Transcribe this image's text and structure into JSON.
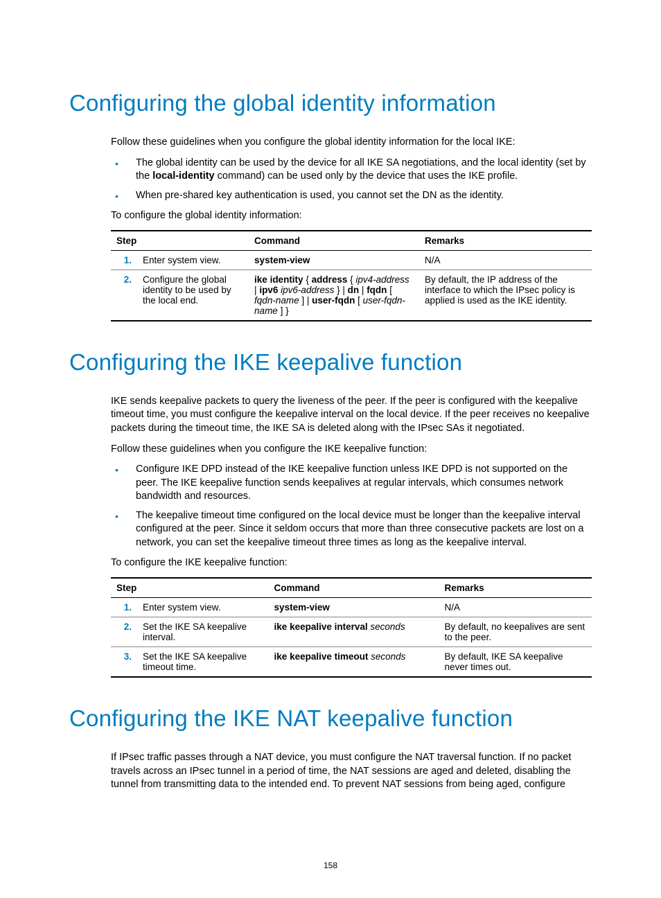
{
  "page_number": "158",
  "sections": [
    {
      "heading": "Configuring the global identity information",
      "intro_paragraphs": [
        "Follow these guidelines when you configure the global identity information for the local IKE:"
      ],
      "bullets": [
        {
          "pre": "The global identity can be used by the device for all IKE SA negotiations, and the local identity (set by the ",
          "bold": "local-identity",
          "post": " command) can be used only by the device that uses the IKE profile."
        },
        {
          "pre": "When pre-shared key authentication is used, you cannot set the DN as the identity.",
          "bold": "",
          "post": ""
        }
      ],
      "lead_out": "To configure the global identity information:",
      "table_headers": {
        "step": "Step",
        "command": "Command",
        "remarks": "Remarks"
      },
      "rows": [
        {
          "num": "1.",
          "desc": "Enter system view.",
          "command_segments": [
            {
              "t": "system-view",
              "b": true
            }
          ],
          "remarks": "N/A"
        },
        {
          "num": "2.",
          "desc": "Configure the global identity to be used by the local end.",
          "command_segments": [
            {
              "t": "ike identity",
              "b": true
            },
            {
              "t": " { "
            },
            {
              "t": "address",
              "b": true
            },
            {
              "t": " { "
            },
            {
              "t": "ipv4-address",
              "i": true
            },
            {
              "t": " | "
            },
            {
              "t": "ipv6",
              "b": true
            },
            {
              "t": " "
            },
            {
              "t": "ipv6-address",
              "i": true
            },
            {
              "t": " } | "
            },
            {
              "t": "dn",
              "b": true
            },
            {
              "t": " | "
            },
            {
              "t": "fqdn",
              "b": true
            },
            {
              "t": " [ "
            },
            {
              "t": "fqdn-name",
              "i": true
            },
            {
              "t": " ] | "
            },
            {
              "t": "user-fqdn",
              "b": true
            },
            {
              "t": " [ "
            },
            {
              "t": "user-fqdn-name",
              "i": true
            },
            {
              "t": " ] }"
            }
          ],
          "remarks": "By default, the IP address of the interface to which the IPsec policy is applied is used as the IKE identity."
        }
      ]
    },
    {
      "heading": "Configuring the IKE keepalive function",
      "intro_paragraphs": [
        "IKE sends keepalive packets to query the liveness of the peer. If the peer is configured with the keepalive timeout time, you must configure the keepalive interval on the local device. If the peer receives no keepalive packets during the timeout time, the IKE SA is deleted along with the IPsec SAs it negotiated.",
        "Follow these guidelines when you configure the IKE keepalive function:"
      ],
      "bullets": [
        {
          "pre": "Configure IKE DPD instead of the IKE keepalive function unless IKE DPD is not supported on the peer. The IKE keepalive function sends keepalives at regular intervals, which consumes network bandwidth and resources.",
          "bold": "",
          "post": ""
        },
        {
          "pre": "The keepalive timeout time configured on the local device must be longer than the keepalive interval configured at the peer. Since it seldom occurs that more than three consecutive packets are lost on a network, you can set the keepalive timeout three times as long as the keepalive interval.",
          "bold": "",
          "post": ""
        }
      ],
      "lead_out": "To configure the IKE keepalive function:",
      "table_headers": {
        "step": "Step",
        "command": "Command",
        "remarks": "Remarks"
      },
      "rows": [
        {
          "num": "1.",
          "desc": "Enter system view.",
          "command_segments": [
            {
              "t": "system-view",
              "b": true
            }
          ],
          "remarks": "N/A"
        },
        {
          "num": "2.",
          "desc": "Set the IKE SA keepalive interval.",
          "command_segments": [
            {
              "t": "ike keepalive interval",
              "b": true
            },
            {
              "t": " "
            },
            {
              "t": "seconds",
              "i": true
            }
          ],
          "remarks": "By default, no keepalives are sent to the peer."
        },
        {
          "num": "3.",
          "desc": "Set the IKE SA keepalive timeout time.",
          "command_segments": [
            {
              "t": "ike keepalive timeout",
              "b": true
            },
            {
              "t": " "
            },
            {
              "t": "seconds",
              "i": true
            }
          ],
          "remarks": "By default, IKE SA keepalive never times out."
        }
      ]
    },
    {
      "heading": "Configuring the IKE NAT keepalive function",
      "intro_paragraphs": [
        "If IPsec traffic passes through a NAT device, you must configure the NAT traversal function. If no packet travels across an IPsec tunnel in a period of time, the NAT sessions are aged and deleted, disabling the tunnel from transmitting data to the intended end. To prevent NAT sessions from being aged, configure"
      ],
      "bullets": [],
      "lead_out": "",
      "table_headers": null,
      "rows": []
    }
  ]
}
